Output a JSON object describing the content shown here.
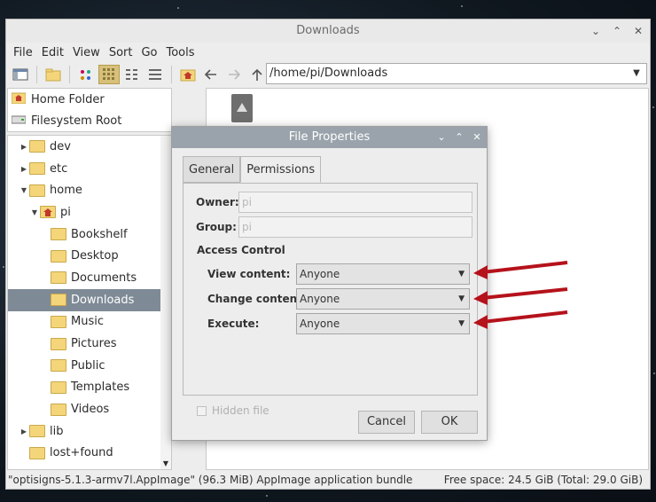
{
  "window": {
    "title": "Downloads",
    "controls": [
      "⌄",
      "⌃",
      "✕"
    ]
  },
  "menu": [
    "File",
    "Edit",
    "View",
    "Sort",
    "Go",
    "Tools"
  ],
  "path": "/home/pi/Downloads",
  "places": [
    {
      "label": "Home Folder",
      "icon": "home-folder-icon"
    },
    {
      "label": "Filesystem Root",
      "icon": "drive-icon"
    }
  ],
  "tree": [
    {
      "label": "dev",
      "indent": 0,
      "expander": "right",
      "selected": false
    },
    {
      "label": "etc",
      "indent": 0,
      "expander": "right",
      "selected": false
    },
    {
      "label": "home",
      "indent": 0,
      "expander": "down",
      "selected": false
    },
    {
      "label": "pi",
      "indent": 1,
      "expander": "down",
      "selected": false,
      "home": true
    },
    {
      "label": "Bookshelf",
      "indent": 2,
      "expander": "",
      "selected": false
    },
    {
      "label": "Desktop",
      "indent": 2,
      "expander": "",
      "selected": false
    },
    {
      "label": "Documents",
      "indent": 2,
      "expander": "",
      "selected": false
    },
    {
      "label": "Downloads",
      "indent": 2,
      "expander": "",
      "selected": true
    },
    {
      "label": "Music",
      "indent": 2,
      "expander": "",
      "selected": false
    },
    {
      "label": "Pictures",
      "indent": 2,
      "expander": "",
      "selected": false
    },
    {
      "label": "Public",
      "indent": 2,
      "expander": "",
      "selected": false
    },
    {
      "label": "Templates",
      "indent": 2,
      "expander": "",
      "selected": false
    },
    {
      "label": "Videos",
      "indent": 2,
      "expander": "",
      "selected": false
    },
    {
      "label": "lib",
      "indent": 0,
      "expander": "right",
      "selected": false
    },
    {
      "label": "lost+found",
      "indent": 0,
      "expander": "",
      "selected": false
    }
  ],
  "status": {
    "left": "\"optisigns-5.1.3-armv7l.AppImage\" (96.3 MiB) AppImage application bundle",
    "right": "Free space: 24.5 GiB (Total: 29.0 GiB)"
  },
  "dialog": {
    "title": "File Properties",
    "tabs": [
      "General",
      "Permissions"
    ],
    "active_tab": "Permissions",
    "owner_label": "Owner:",
    "owner_value": "pi",
    "group_label": "Group:",
    "group_value": "pi",
    "access_heading": "Access Control",
    "view_label": "View content:",
    "view_value": "Anyone",
    "change_label": "Change content:",
    "change_value": "Anyone",
    "exec_label": "Execute:",
    "exec_value": "Anyone",
    "hidden_label": "Hidden file",
    "cancel": "Cancel",
    "ok": "OK"
  },
  "colors": {
    "selection": "#7e8a95",
    "dialog_title": "#9aa3ab",
    "annotation_arrow": "#b5121b"
  }
}
